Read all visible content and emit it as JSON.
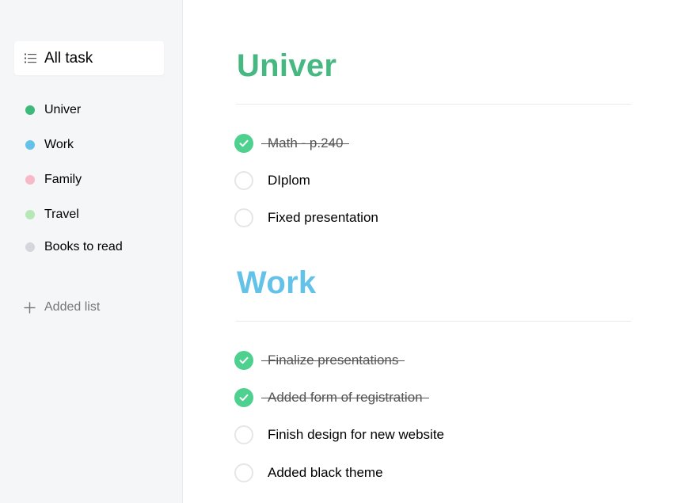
{
  "sidebar": {
    "all_task": {
      "label": "All task",
      "icon": "list-icon"
    },
    "lists": [
      {
        "label": "Univer",
        "color": "#3dba7a"
      },
      {
        "label": "Work",
        "color": "#64c1e8"
      },
      {
        "label": "Family",
        "color": "#f7b8c8"
      },
      {
        "label": "Travel",
        "color": "#b5e8b5"
      },
      {
        "label": "Books to read",
        "color": "#d3d6da"
      }
    ],
    "add_list": {
      "label": "Added list",
      "icon": "plus-icon"
    }
  },
  "sections": [
    {
      "title": "Univer",
      "color": "#48b882",
      "tasks": [
        {
          "text": "Math - p.240",
          "done": true
        },
        {
          "text": "DIplom",
          "done": false
        },
        {
          "text": "Fixed presentation",
          "done": false
        }
      ]
    },
    {
      "title": "Work",
      "color": "#64c1e8",
      "tasks": [
        {
          "text": "Finalize presentations",
          "done": true
        },
        {
          "text": "Added form of registration",
          "done": true
        },
        {
          "text": "Finish design for new website",
          "done": false
        },
        {
          "text": "Added black theme",
          "done": false
        }
      ]
    }
  ]
}
